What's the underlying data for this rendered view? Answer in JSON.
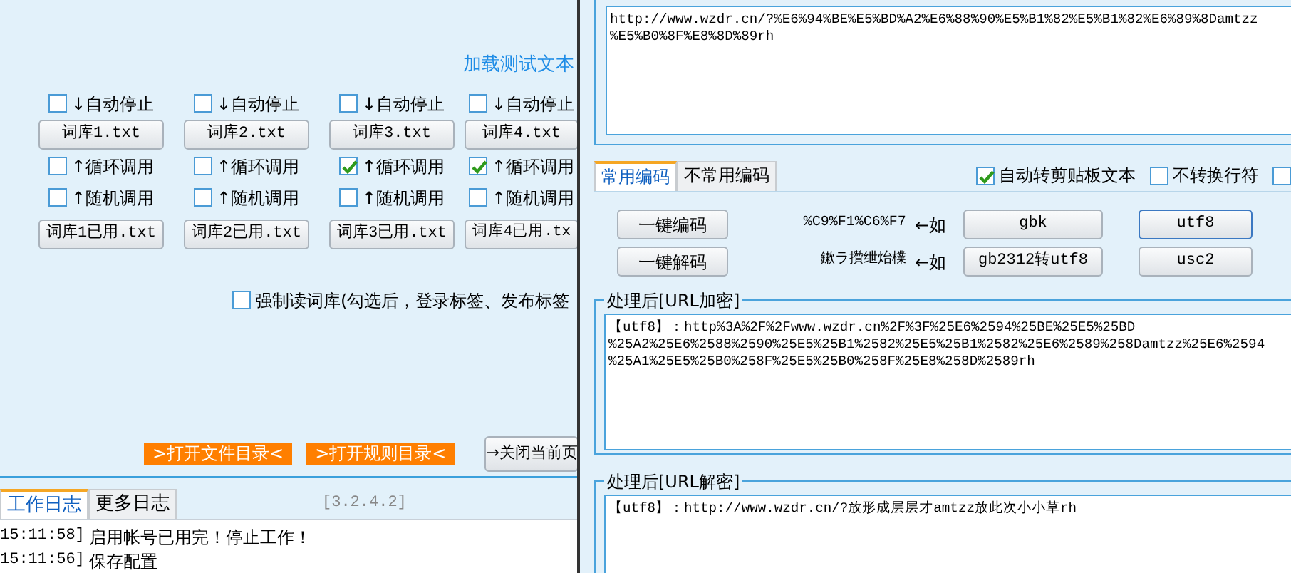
{
  "left": {
    "load_link": "加载测试文本",
    "columns": [
      {
        "auto_stop": {
          "label": "↓自动停止",
          "checked": false
        },
        "lib_button": "词库1.txt",
        "loop": {
          "label": "↑循环调用",
          "checked": false
        },
        "random": {
          "label": "↑随机调用",
          "checked": false
        },
        "used_button": "词库1已用.txt"
      },
      {
        "auto_stop": {
          "label": "↓自动停止",
          "checked": false
        },
        "lib_button": "词库2.txt",
        "loop": {
          "label": "↑循环调用",
          "checked": false
        },
        "random": {
          "label": "↑随机调用",
          "checked": false
        },
        "used_button": "词库2已用.txt"
      },
      {
        "auto_stop": {
          "label": "↓自动停止",
          "checked": false
        },
        "lib_button": "词库3.txt",
        "loop": {
          "label": "↑循环调用",
          "checked": true
        },
        "random": {
          "label": "↑随机调用",
          "checked": false
        },
        "used_button": "词库3已用.txt"
      },
      {
        "auto_stop": {
          "label": "↓自动停止",
          "checked": false
        },
        "lib_button": "词库4.txt",
        "loop": {
          "label": "↑循环调用",
          "checked": true
        },
        "random": {
          "label": "↑随机调用",
          "checked": false
        },
        "used_button": "词库4已用.tx"
      }
    ],
    "force_read": {
      "label": "强制读词库(勾选后，登录标签、发布标签",
      "checked": false
    },
    "folder_buttons": [
      ">打开文件目录<",
      ">打开规则目录<"
    ],
    "close_button": "→关闭当前页",
    "log_tabs": [
      {
        "label": "工作日志",
        "selected": true
      },
      {
        "label": "更多日志",
        "selected": false
      }
    ],
    "version": "[3.2.4.2]",
    "log": [
      {
        "time": "15:11:58]",
        "message": "启用帐号已用完！停止工作！"
      },
      {
        "time": "15:11:56]",
        "message": "保存配置"
      }
    ]
  },
  "right": {
    "source_lines": [
      "http://www.wzdr.cn/?%E6%94%BE%E5%BD%A2%E6%88%90%E5%B1%82%E5%B1%82%E6%89%8Damtzz",
      "%E5%B0%8F%E8%8D%89rh"
    ],
    "tabs": [
      {
        "label": "常用编码",
        "selected": true
      },
      {
        "label": "不常用编码",
        "selected": false
      }
    ],
    "options": [
      {
        "label": "自动转剪贴板文本",
        "checked": true
      },
      {
        "label": "不转换行符",
        "checked": false
      },
      {
        "checked": false
      }
    ],
    "action_buttons": [
      "一键编码",
      "一键解码"
    ],
    "examples": [
      {
        "sample": "%C9%F1%C6%F7",
        "note": "←如"
      },
      {
        "sample": "鏉ラ攢绁炲檏",
        "note": "←如"
      }
    ],
    "charset_buttons": [
      {
        "label": "gbk",
        "focused": false
      },
      {
        "label": "utf8",
        "focused": true
      },
      {
        "label": "gb2312转utf8",
        "focused": false
      },
      {
        "label": "usc2",
        "focused": false
      }
    ],
    "encoded": {
      "title": "处理后[URL加密]",
      "lines": [
        "【utf8】：http%3A%2F%2Fwww.wzdr.cn%2F%3F%25E6%2594%25BE%25E5%25BD",
        "%25A2%25E6%2588%2590%25E5%25B1%2582%25E5%25B1%2582%25E6%2589%258Damtzz%25E6%2594",
        "%25A1%25E5%25B0%258F%25E5%25B0%258F%25E8%258D%2589rh"
      ]
    },
    "decoded": {
      "title": "处理后[URL解密]",
      "lines": [
        "【utf8】：http://www.wzdr.cn/?放形成层层才amtzz放此次小小草rh"
      ]
    }
  }
}
